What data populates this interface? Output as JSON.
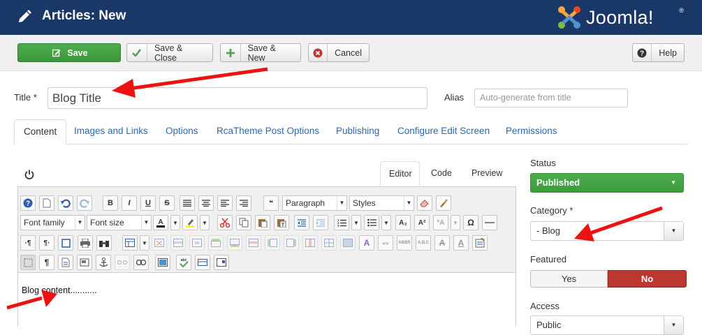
{
  "header": {
    "title": "Articles: New",
    "brand": "Joomla!",
    "brand_mark": "®"
  },
  "toolbar": {
    "save": "Save",
    "save_close": "Save & Close",
    "save_new": "Save & New",
    "cancel": "Cancel",
    "help": "Help"
  },
  "form": {
    "title_label": "Title *",
    "title_value": "Blog Title",
    "alias_label": "Alias",
    "alias_placeholder": "Auto-generate from title"
  },
  "tabs": [
    "Content",
    "Images and Links",
    "Options",
    "RcaTheme Post Options",
    "Publishing",
    "Configure Edit Screen",
    "Permissions"
  ],
  "editor": {
    "tabs": [
      "Editor",
      "Code",
      "Preview"
    ],
    "format_select": "Paragraph",
    "styles_select": "Styles",
    "font_family": "Font family",
    "font_size": "Font size",
    "content": "Blog content..........."
  },
  "sidebar": {
    "status_label": "Status",
    "status_value": "Published",
    "category_label": "Category *",
    "category_value": "- Blog",
    "featured_label": "Featured",
    "featured_yes": "Yes",
    "featured_no": "No",
    "access_label": "Access",
    "access_value": "Public"
  },
  "colors": {
    "header_bg": "#1a3867",
    "save_green": "#47a447",
    "tab_link": "#2a69b8",
    "featured_no": "#bd362f",
    "annotation_arrow": "#ee1111"
  }
}
